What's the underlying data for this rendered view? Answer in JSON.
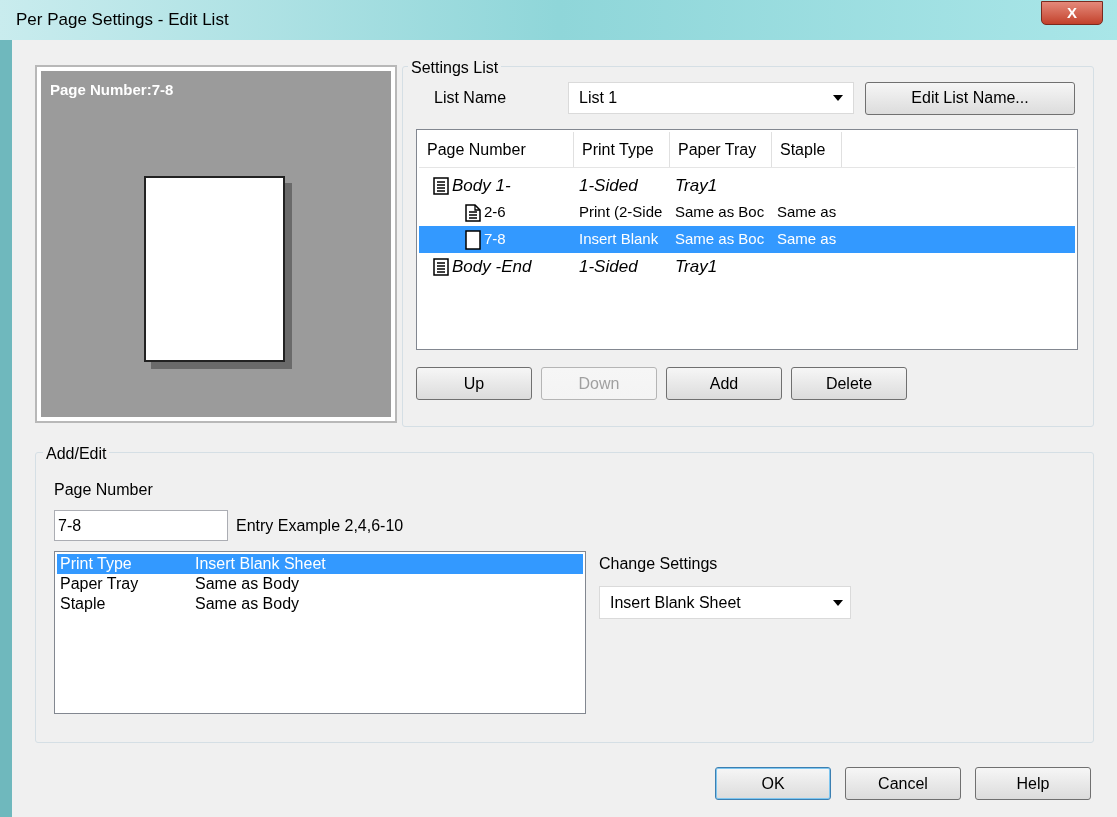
{
  "window": {
    "title": "Per Page Settings - Edit List",
    "close": "X"
  },
  "preview": {
    "label": "Page Number:7-8"
  },
  "settings_list": {
    "title": "Settings List",
    "list_name_label": "List Name",
    "list_name_value": "List 1",
    "edit_button": "Edit List Name...",
    "columns": [
      "Page Number",
      "Print Type",
      "Paper Tray",
      "Staple"
    ],
    "rows": [
      {
        "kind": "body",
        "page_number": "Body 1-",
        "print_type": "1-Sided",
        "paper_tray": "Tray1",
        "selected": false,
        "children": [
          {
            "kind": "duplex",
            "page_number": "2-6",
            "print_type": "Print (2-Side",
            "paper_tray": "Same as Boc",
            "staple": "Same as",
            "selected": false
          },
          {
            "kind": "blank",
            "page_number": "7-8",
            "print_type": "Insert Blank",
            "paper_tray": "Same as Boc",
            "staple": "Same as",
            "selected": true
          }
        ]
      },
      {
        "kind": "body",
        "page_number": "Body -End",
        "print_type": "1-Sided",
        "paper_tray": "Tray1",
        "selected": false
      }
    ],
    "buttons": [
      {
        "label": "Up",
        "disabled": false
      },
      {
        "label": "Down",
        "disabled": true
      },
      {
        "label": "Add",
        "disabled": false
      },
      {
        "label": "Delete",
        "disabled": false
      }
    ]
  },
  "add_edit": {
    "title": "Add/Edit",
    "page_number_label": "Page Number",
    "page_number_value": "7-8",
    "entry_example": "Entry Example 2,4,6-10",
    "settings": [
      {
        "name": "Print Type",
        "value": "Insert Blank Sheet",
        "selected": true
      },
      {
        "name": "Paper Tray",
        "value": "Same as Body",
        "selected": false
      },
      {
        "name": "Staple",
        "value": "Same as Body",
        "selected": false
      }
    ],
    "change_settings_label": "Change Settings",
    "change_settings_value": "Insert Blank Sheet"
  },
  "footer_buttons": [
    {
      "label": "OK",
      "default": true
    },
    {
      "label": "Cancel",
      "default": false
    },
    {
      "label": "Help",
      "default": false
    }
  ]
}
